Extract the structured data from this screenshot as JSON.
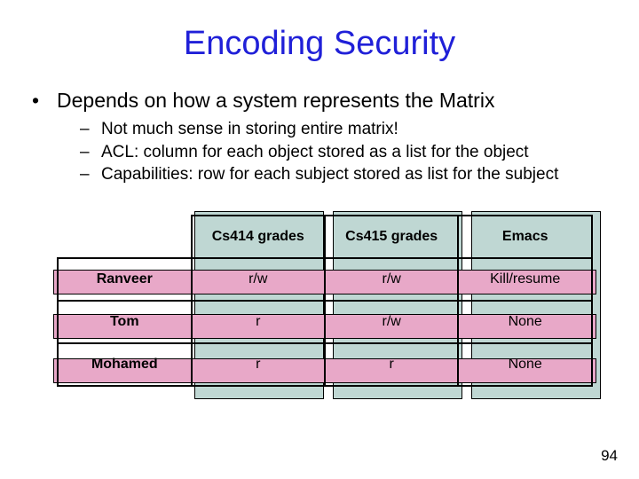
{
  "title": "Encoding Security",
  "bullet": "Depends on how a system represents the Matrix",
  "subs": [
    "Not much sense in storing entire matrix!",
    "ACL: column for each object stored as a list for the object",
    "Capabilities: row for each subject stored as list for the subject"
  ],
  "table": {
    "cols": [
      "Cs414 grades",
      "Cs415 grades",
      "Emacs"
    ],
    "rows": [
      "Ranveer",
      "Tom",
      "Mohamed"
    ],
    "cells": [
      [
        "r/w",
        "r/w",
        "Kill/resume"
      ],
      [
        "r",
        "r/w",
        "None"
      ],
      [
        "r",
        "r",
        "None"
      ]
    ]
  },
  "page": "94",
  "glyphs": {
    "dot": "•",
    "dash": "–"
  }
}
